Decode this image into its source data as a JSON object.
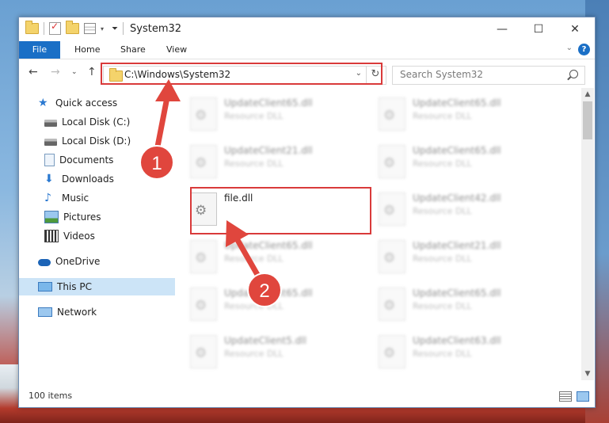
{
  "window": {
    "title": "System32"
  },
  "ribbon": {
    "tabs": [
      "File",
      "Home",
      "Share",
      "View"
    ],
    "help": "?"
  },
  "address": {
    "path": "C:\\Windows\\System32"
  },
  "search": {
    "placeholder": "Search System32"
  },
  "sidebar": {
    "items": [
      {
        "label": "Quick access"
      },
      {
        "label": "Local Disk (C:)"
      },
      {
        "label": "Local Disk (D:)"
      },
      {
        "label": "Documents"
      },
      {
        "label": "Downloads"
      },
      {
        "label": "Music"
      },
      {
        "label": "Pictures"
      },
      {
        "label": "Videos"
      },
      {
        "label": "OneDrive"
      },
      {
        "label": "This PC"
      },
      {
        "label": "Network"
      }
    ]
  },
  "files": {
    "left": [
      {
        "name": "UpdateClient65.dll",
        "type": "Resource DLL"
      },
      {
        "name": "UpdateClient21.dll",
        "type": "Resource DLL"
      },
      {
        "name": "file.dll",
        "type": ""
      },
      {
        "name": "UpdateClient65.dll",
        "type": "Resource DLL"
      },
      {
        "name": "UpdateClient65.dll",
        "type": "Resource DLL"
      },
      {
        "name": "UpdateClient5.dll",
        "type": "Resource DLL"
      }
    ],
    "right": [
      {
        "name": "UpdateClient65.dll",
        "type": "Resource DLL"
      },
      {
        "name": "UpdateClient65.dll",
        "type": "Resource DLL"
      },
      {
        "name": "UpdateClient42.dll",
        "type": "Resource DLL"
      },
      {
        "name": "UpdateClient21.dll",
        "type": "Resource DLL"
      },
      {
        "name": "UpdateClient65.dll",
        "type": "Resource DLL"
      },
      {
        "name": "UpdateClient63.dll",
        "type": "Resource DLL"
      }
    ]
  },
  "status": {
    "items": "100 items"
  },
  "annotations": {
    "step1": "1",
    "step2": "2",
    "color": "#e0463d"
  }
}
